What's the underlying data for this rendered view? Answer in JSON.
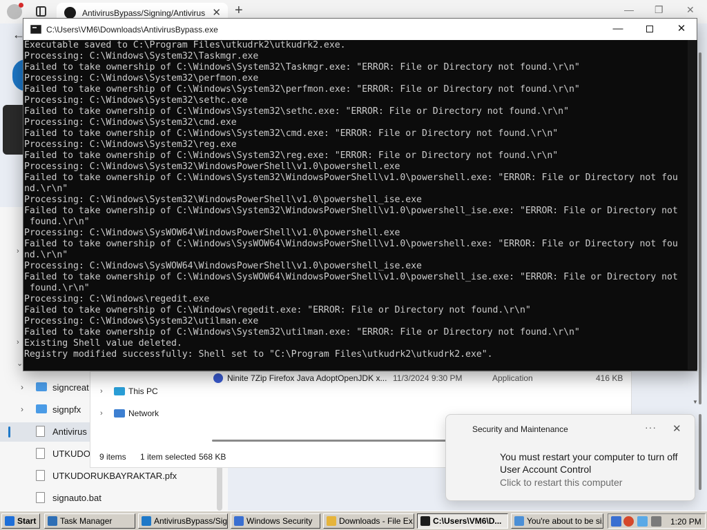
{
  "browser": {
    "tab_title": "AntivirusBypass/Signing/Antivirus",
    "tab_close": "✕",
    "new_tab": "+",
    "minimize": "—",
    "restore": "❐",
    "close": "✕"
  },
  "explorer": {
    "nav_items": [
      {
        "label": "signcreat",
        "type": "folder"
      },
      {
        "label": "signpfx",
        "type": "folder"
      },
      {
        "label": "Antivirus",
        "type": "file",
        "selected": true
      },
      {
        "label": "UTKUDO",
        "type": "file"
      },
      {
        "label": "UTKUDORUKBAYRAKTAR.pfx",
        "type": "file"
      },
      {
        "label": "signauto.bat",
        "type": "file"
      }
    ],
    "file_row": {
      "name": "Ninite 7Zip Firefox Java AdoptOpenJDK x...",
      "date": "11/3/2024 9:30 PM",
      "type": "Application",
      "size": "416 KB"
    },
    "tree": [
      {
        "label": "This PC"
      },
      {
        "label": "Network"
      }
    ],
    "status": {
      "items": "9 items",
      "selected": "1 item selected",
      "size": "568 KB"
    }
  },
  "console": {
    "title": "C:\\Users\\VM6\\Downloads\\AntivirusBypass.exe",
    "controls": {
      "minimize": "—",
      "close": "✕"
    },
    "lines": [
      "Executable saved to C:\\Program Files\\utkudrk2\\utkudrk2.exe.",
      "Processing: C:\\Windows\\System32\\Taskmgr.exe",
      "Failed to take ownership of C:\\Windows\\System32\\Taskmgr.exe: \"ERROR: File or Directory not found.\\r\\n\"",
      "Processing: C:\\Windows\\System32\\perfmon.exe",
      "Failed to take ownership of C:\\Windows\\System32\\perfmon.exe: \"ERROR: File or Directory not found.\\r\\n\"",
      "Processing: C:\\Windows\\System32\\sethc.exe",
      "Failed to take ownership of C:\\Windows\\System32\\sethc.exe: \"ERROR: File or Directory not found.\\r\\n\"",
      "Processing: C:\\Windows\\System32\\cmd.exe",
      "Failed to take ownership of C:\\Windows\\System32\\cmd.exe: \"ERROR: File or Directory not found.\\r\\n\"",
      "Processing: C:\\Windows\\System32\\reg.exe",
      "Failed to take ownership of C:\\Windows\\System32\\reg.exe: \"ERROR: File or Directory not found.\\r\\n\"",
      "Processing: C:\\Windows\\System32\\WindowsPowerShell\\v1.0\\powershell.exe",
      "Failed to take ownership of C:\\Windows\\System32\\WindowsPowerShell\\v1.0\\powershell.exe: \"ERROR: File or Directory not fou",
      "nd.\\r\\n\"",
      "Processing: C:\\Windows\\System32\\WindowsPowerShell\\v1.0\\powershell_ise.exe",
      "Failed to take ownership of C:\\Windows\\System32\\WindowsPowerShell\\v1.0\\powershell_ise.exe: \"ERROR: File or Directory not",
      " found.\\r\\n\"",
      "Processing: C:\\Windows\\SysWOW64\\WindowsPowerShell\\v1.0\\powershell.exe",
      "Failed to take ownership of C:\\Windows\\SysWOW64\\WindowsPowerShell\\v1.0\\powershell.exe: \"ERROR: File or Directory not fou",
      "nd.\\r\\n\"",
      "Processing: C:\\Windows\\SysWOW64\\WindowsPowerShell\\v1.0\\powershell_ise.exe",
      "Failed to take ownership of C:\\Windows\\SysWOW64\\WindowsPowerShell\\v1.0\\powershell_ise.exe: \"ERROR: File or Directory not",
      " found.\\r\\n\"",
      "Processing: C:\\Windows\\regedit.exe",
      "Failed to take ownership of C:\\Windows\\regedit.exe: \"ERROR: File or Directory not found.\\r\\n\"",
      "Processing: C:\\Windows\\System32\\utilman.exe",
      "Failed to take ownership of C:\\Windows\\System32\\utilman.exe: \"ERROR: File or Directory not found.\\r\\n\"",
      "Existing Shell value deleted.",
      "Registry modified successfully: Shell set to \"C:\\Program Files\\utkudrk2\\utkudrk2.exe\"."
    ]
  },
  "toast": {
    "app": "Security and Maintenance",
    "more": "···",
    "close": "✕",
    "message": "You must restart your computer to turn off User Account Control",
    "action": "Click to restart this computer"
  },
  "taskbar": {
    "start": "Start",
    "items": [
      {
        "label": "Task Manager",
        "icon_color": "#2f6fb5"
      },
      {
        "label": "AntivirusBypass/Sig...",
        "icon_color": "#1e78c8"
      },
      {
        "label": "Windows Security",
        "icon_color": "#3a6fd1"
      },
      {
        "label": "Downloads - File Ex...",
        "icon_color": "#e6b43a"
      },
      {
        "label": "C:\\Users\\VM6\\D...",
        "icon_color": "#1c1c1c",
        "active": true
      },
      {
        "label": "You're about to be si...",
        "icon_color": "#4b8fd6"
      }
    ],
    "clock": "1:20 PM"
  }
}
